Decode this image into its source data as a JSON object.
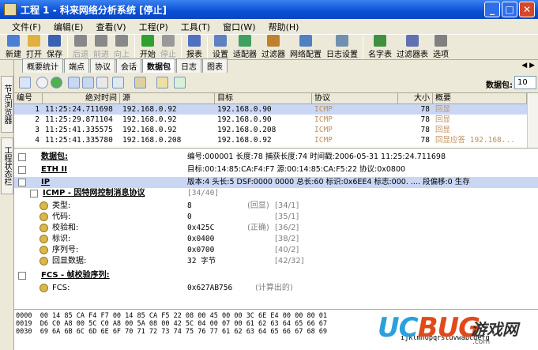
{
  "window": {
    "title": "工程 1 - 科来网络分析系统 [停止]",
    "minimize": "_",
    "maximize": "□",
    "close": "✕"
  },
  "menu": [
    "文件(F)",
    "编辑(E)",
    "查看(V)",
    "工程(P)",
    "工具(T)",
    "窗口(W)",
    "帮助(H)"
  ],
  "toolbar": [
    {
      "label": "新建",
      "icon": "new-icon",
      "color": "#4a7fd4"
    },
    {
      "label": "打开",
      "icon": "open-icon",
      "color": "#e0b040"
    },
    {
      "label": "保存",
      "icon": "save-icon",
      "color": "#3a60b0"
    },
    {
      "label": "后退",
      "icon": "back-icon",
      "color": "#888888",
      "disabled": true
    },
    {
      "label": "前进",
      "icon": "forward-icon",
      "color": "#888888",
      "disabled": true
    },
    {
      "label": "向上",
      "icon": "up-icon",
      "color": "#888888",
      "disabled": true
    },
    {
      "label": "开始",
      "icon": "start-icon",
      "color": "#30a030"
    },
    {
      "label": "停止",
      "icon": "stop-icon",
      "color": "#999999",
      "disabled": true
    },
    {
      "label": "报表",
      "icon": "report-icon",
      "color": "#5070c0"
    },
    {
      "label": "设置",
      "icon": "settings-icon",
      "color": "#6080c0"
    },
    {
      "label": "适配器",
      "icon": "adapter-icon",
      "color": "#40a060"
    },
    {
      "label": "过滤器",
      "icon": "filter-icon",
      "color": "#c08030"
    },
    {
      "label": "网络配置",
      "icon": "network-config-icon",
      "color": "#5080c0"
    },
    {
      "label": "日志设置",
      "icon": "log-settings-icon",
      "color": "#7090b0"
    },
    {
      "label": "名字表",
      "icon": "name-table-icon",
      "color": "#409040"
    },
    {
      "label": "过滤器表",
      "icon": "filter-table-icon",
      "color": "#6070b0"
    },
    {
      "label": "选项",
      "icon": "options-icon",
      "color": "#808080"
    }
  ],
  "side_tabs": [
    "节点浏览器",
    "工程状态栏"
  ],
  "tabs": [
    {
      "label": "概要统计",
      "active": false
    },
    {
      "label": "端点",
      "active": false
    },
    {
      "label": "协议",
      "active": false
    },
    {
      "label": "会话",
      "active": false
    },
    {
      "label": "数据包",
      "active": true
    },
    {
      "label": "日志",
      "active": false
    },
    {
      "label": "图表",
      "active": false
    }
  ],
  "tab_nav": "◀ ▶",
  "packet_count": {
    "label": "数据包:",
    "value": "10"
  },
  "table": {
    "columns": [
      "编号",
      "绝对时间",
      "源",
      "目标",
      "协议",
      "大小",
      "概要"
    ],
    "rows": [
      [
        "1",
        "11:25:24.711698",
        "192.168.0.92",
        "192.168.0.90",
        "ICMP",
        "78",
        "回显"
      ],
      [
        "2",
        "11:25:29.871104",
        "192.168.0.92",
        "192.168.0.90",
        "ICMP",
        "78",
        "回显"
      ],
      [
        "3",
        "11:25:41.335575",
        "192.168.0.92",
        "192.168.0.208",
        "ICMP",
        "78",
        "回显"
      ],
      [
        "4",
        "11:25:41.335780",
        "192.168.0.208",
        "192.168.0.92",
        "ICMP",
        "78",
        "回显应答 192.168..."
      ]
    ]
  },
  "tree": {
    "packet": {
      "name": "数据包:",
      "detail": "编号:000001 长度:78 捕获长度:74 时间戳:2006-05-31 11:25:24.711698"
    },
    "eth": {
      "name": "ETH II",
      "detail": "目标:00:14:85:CA:F4:F7 源:00:14:85:CA:F5:22 协议:0x0800"
    },
    "ip": {
      "name": "IP",
      "detail": "版本:4 头长:5 DSF:0000 0000 总长:60 标识:0x6EE4 标志:000. .... 段偏移:0 生存"
    },
    "icmp": {
      "name": "ICMP - 因特网控制消息协议",
      "range": "[34/40]"
    },
    "fields": [
      {
        "name": "类型:",
        "value": "8",
        "note": "(回显)",
        "range": "[34/1]"
      },
      {
        "name": "代码:",
        "value": "0",
        "note": "",
        "range": "[35/1]"
      },
      {
        "name": "校验和:",
        "value": "0x425C",
        "note": "(正确)",
        "range": "[36/2]"
      },
      {
        "name": "标识:",
        "value": "0x0400",
        "note": "",
        "range": "[38/2]"
      },
      {
        "name": "序列号:",
        "value": "0x0700",
        "note": "",
        "range": "[40/2]"
      },
      {
        "name": "回显数据:",
        "value": "32 字节",
        "note": "",
        "range": "[42/32]"
      }
    ],
    "fcs": {
      "name": "FCS - 帧校验序列:",
      "field": "FCS:",
      "value": "0x627AB756",
      "note": "(计算出的)"
    }
  },
  "hex": {
    "lines": [
      "0000  00 14 85 CA F4 F7 00 14 85 CA F5 22 08 00 45 00 00 3C 6E E4 00 00 80 01",
      "0019  D6 C0 A8 00 5C C0 A8 00 5A 08 00 42 5C 04 00 07 00 61 62 63 64 65 66 67",
      "0030  69 6A 6B 6C 6D 6E 6F 70 71 72 73 74 75 76 77 61 62 63 64 65 66 67 68 69"
    ],
    "ascii": "ijklmnopqrstuvwabcdefg"
  },
  "watermark": {
    "brand_a": "UC",
    "brand_b": "BUG",
    "site": "游戏网",
    "url": ".com"
  }
}
